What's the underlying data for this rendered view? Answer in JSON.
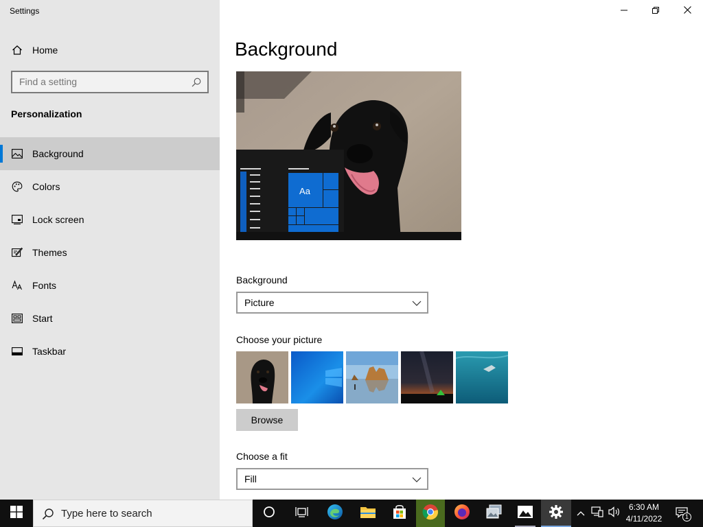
{
  "window": {
    "title": "Settings",
    "minimize_icon": "minimize-icon",
    "restore_icon": "restore-icon",
    "close_icon": "close-icon"
  },
  "sidebar": {
    "home": {
      "label": "Home",
      "icon": "home-icon"
    },
    "search": {
      "placeholder": "Find a setting",
      "icon": "search-icon"
    },
    "section_heading": "Personalization",
    "items": [
      {
        "label": "Background",
        "icon": "image-icon",
        "selected": true
      },
      {
        "label": "Colors",
        "icon": "palette-icon",
        "selected": false
      },
      {
        "label": "Lock screen",
        "icon": "lock-screen-icon",
        "selected": false
      },
      {
        "label": "Themes",
        "icon": "themes-icon",
        "selected": false
      },
      {
        "label": "Fonts",
        "icon": "fonts-icon",
        "selected": false
      },
      {
        "label": "Start",
        "icon": "start-icon",
        "selected": false
      },
      {
        "label": "Taskbar",
        "icon": "taskbar-icon",
        "selected": false
      }
    ],
    "selection_accent": "#0078d7"
  },
  "main": {
    "title": "Background",
    "preview": {
      "tile_label": "Aa",
      "accent": "#0078d7"
    },
    "background_field": {
      "label": "Background",
      "value": "Picture"
    },
    "picture_section": {
      "label": "Choose your picture",
      "thumbnails": [
        {
          "name": "black dog on carpet"
        },
        {
          "name": "windows blue default"
        },
        {
          "name": "beach rocks reflection"
        },
        {
          "name": "night sky with tent"
        },
        {
          "name": "underwater swimmer"
        }
      ],
      "browse_label": "Browse"
    },
    "fit_field": {
      "label": "Choose a fit",
      "value": "Fill"
    }
  },
  "taskbar": {
    "start_icon": "windows-start-icon",
    "search_placeholder": "Type here to search",
    "apps": [
      "cortana-icon",
      "task-view-icon",
      "edge-icon",
      "file-explorer-icon",
      "microsoft-store-icon",
      "chrome-icon",
      "firefox-icon",
      "photos-app-icon",
      "photos-icon",
      "settings-icon"
    ],
    "tray": {
      "time": "6:30 AM",
      "date": "4/11/2022",
      "notification_count": "1"
    }
  }
}
